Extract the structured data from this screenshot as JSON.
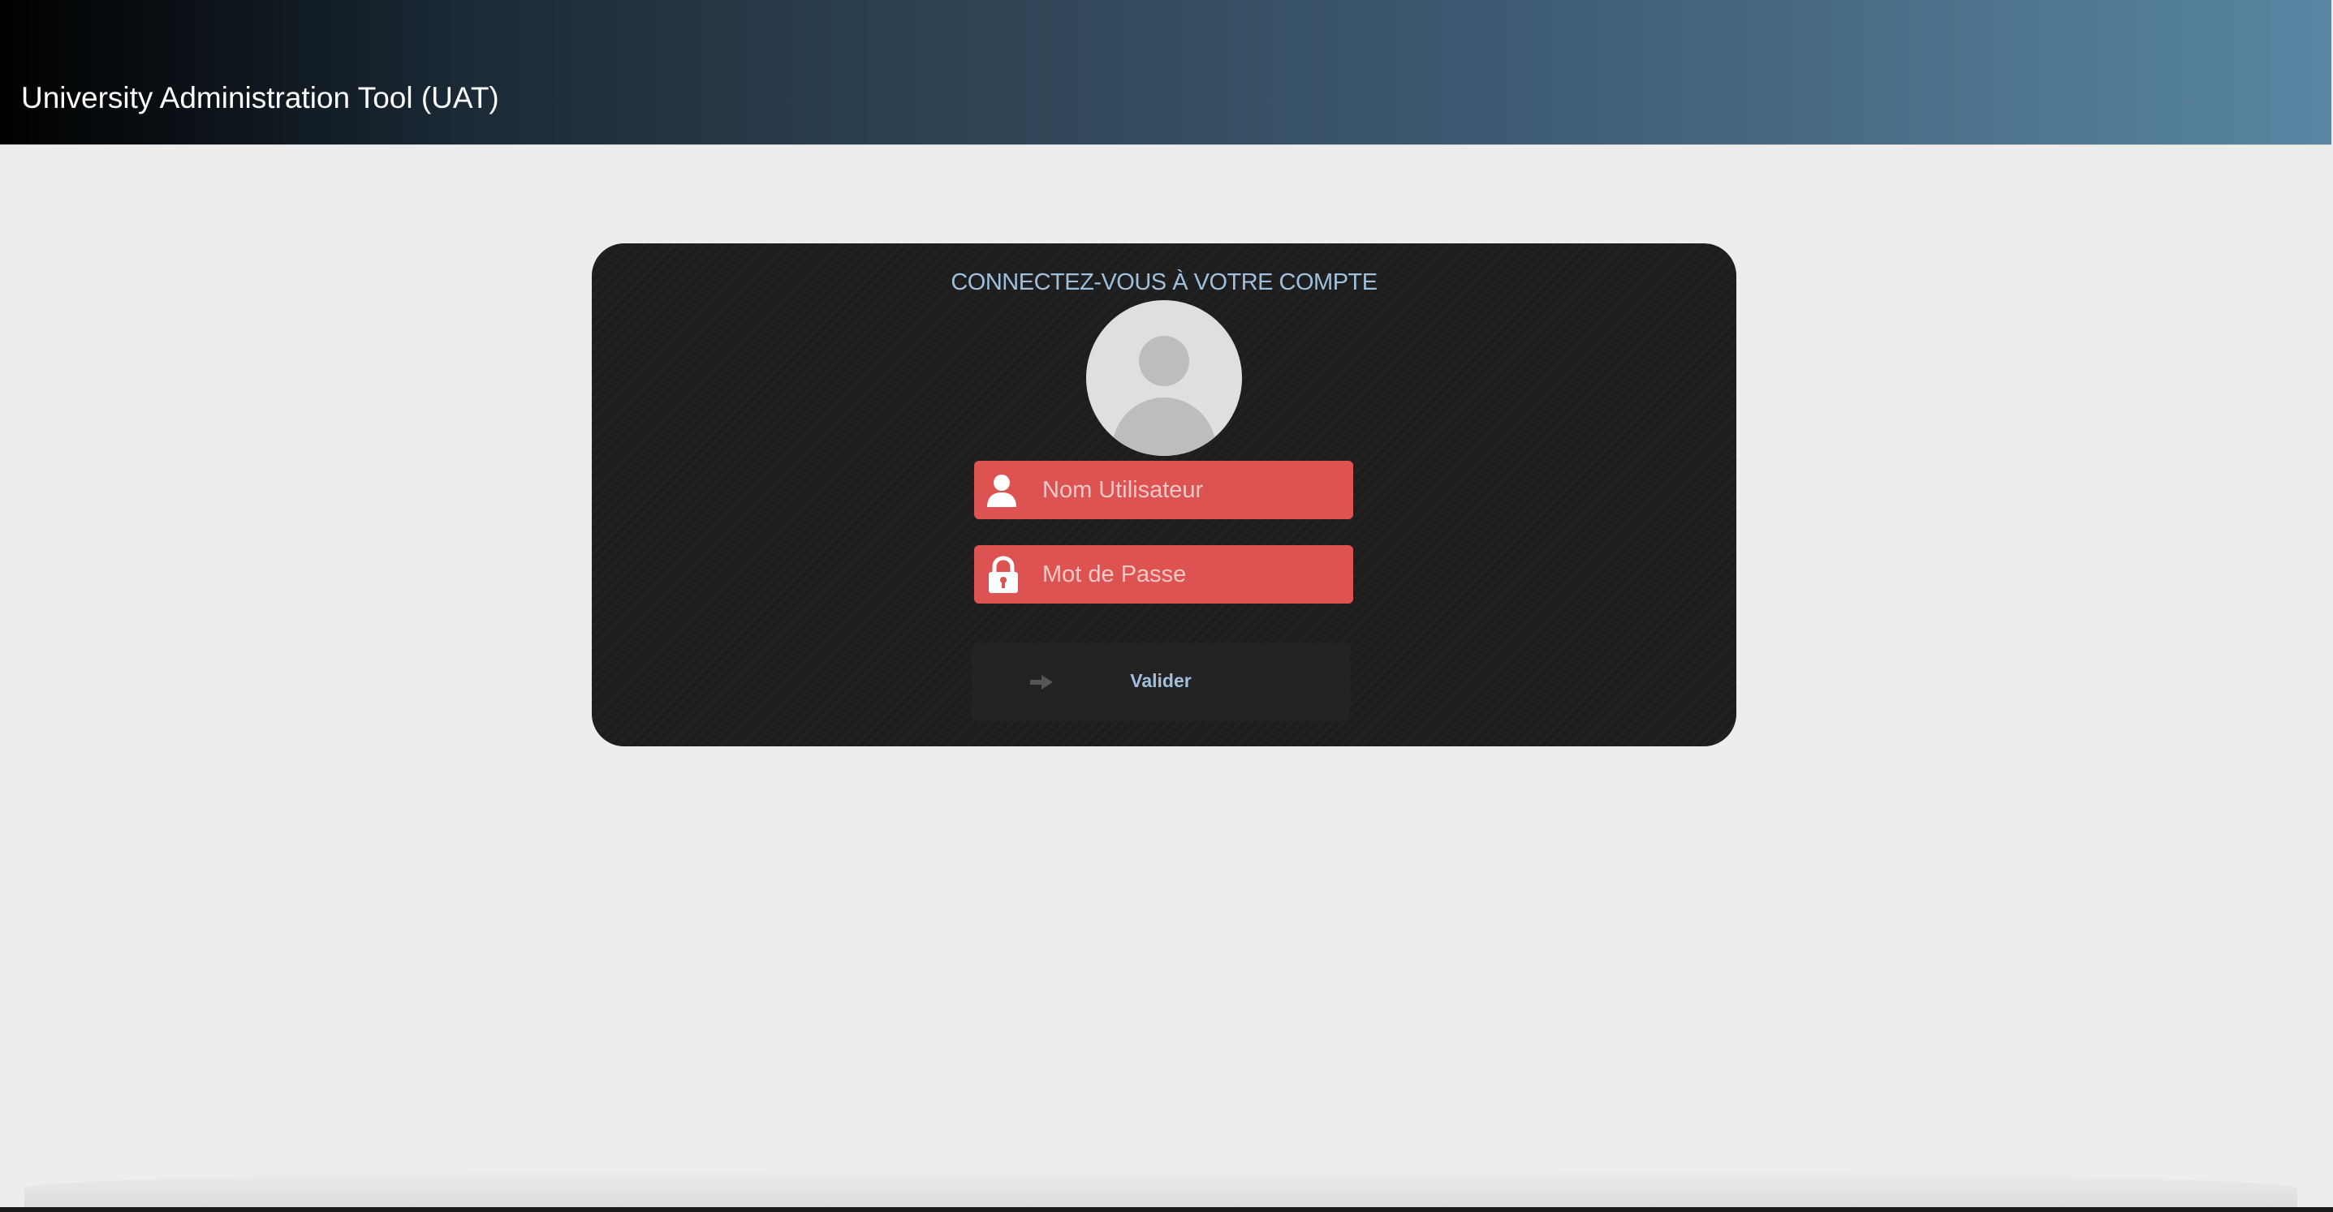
{
  "header": {
    "title": "University Administration Tool (UAT)"
  },
  "login": {
    "title": "CONNECTEZ-VOUS À VOTRE COMPTE",
    "username_placeholder": "Nom Utilisateur",
    "username_value": "",
    "password_placeholder": "Mot de Passe",
    "password_value": "",
    "submit_label": "Valider"
  },
  "icons": {
    "avatar": "user-avatar-icon",
    "username": "user-icon",
    "password": "lock-icon",
    "submit": "arrow-right-icon"
  },
  "colors": {
    "field_background": "#dc5352",
    "card_background": "#1d1d1d",
    "accent_text": "#9fc0dc"
  }
}
